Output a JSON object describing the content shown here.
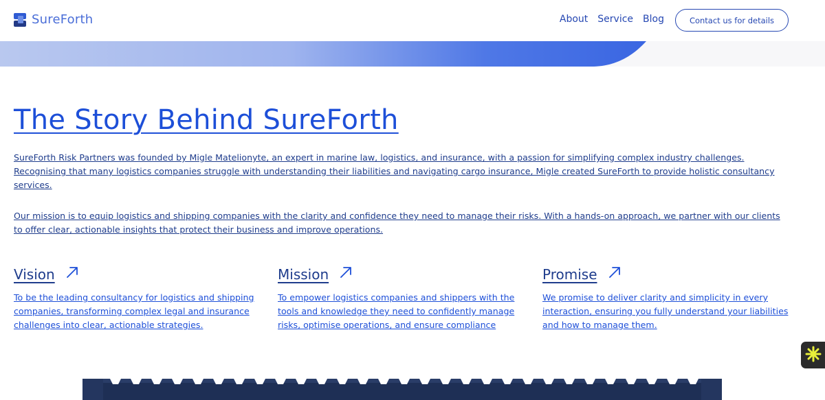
{
  "header": {
    "logo_text": "SureForth",
    "nav": [
      "About",
      "Service",
      "Blog"
    ],
    "cta_label": "Contact us for details"
  },
  "main": {
    "title": "The Story Behind SureForth",
    "paragraphs": [
      "SureForth Risk Partners was founded by Migle Matelionyte, an expert in marine law, logistics, and insurance, with a passion for simplifying complex industry challenges. Recognising that many logistics companies struggle with understanding their liabilities and navigating cargo insurance, Migle created SureForth to provide holistic consultancy services.",
      "Our mission is to equip logistics and shipping companies with the clarity and confidence they need to manage their risks. With a hands-on approach, we partner with our clients to offer clear, actionable insights that protect their business and improve operations."
    ],
    "columns": [
      {
        "title": "Vision",
        "text": "To be the leading consultancy for logistics and shipping companies, transforming complex legal and insurance challenges into clear, actionable strategies."
      },
      {
        "title": "Mission",
        "text": "To empower logistics companies and shippers with the tools and knowledge they need to confidently manage risks, optimise operations, and ensure compliance"
      },
      {
        "title": "Promise",
        "text": "We promise to deliver clarity and simplicity in every interaction, ensuring you fully understand your liabilities and how to manage them."
      }
    ]
  },
  "icons": {
    "logo": "logo-icon",
    "column_link": "arrow-up-right-icon",
    "widget": "asterisk-icon"
  },
  "colors": {
    "brand_blue": "#1d4fd8",
    "text_navy": "#1e3c8c",
    "widget_bg": "#2b2b2b",
    "widget_accent": "#e8ef3a"
  }
}
